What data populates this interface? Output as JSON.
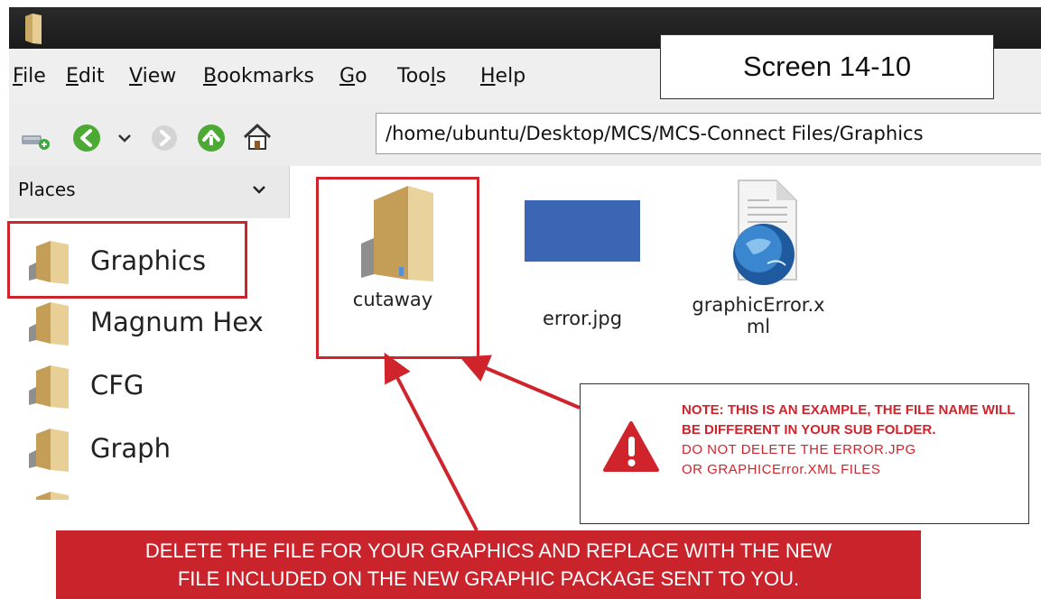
{
  "menu": {
    "items": [
      {
        "mnemonic": "F",
        "rest": "ile"
      },
      {
        "mnemonic": "E",
        "rest": "dit"
      },
      {
        "mnemonic": "V",
        "rest": "iew"
      },
      {
        "mnemonic": "B",
        "rest": "ookmarks"
      },
      {
        "mnemonic": "G",
        "rest": "o"
      },
      {
        "pre": "Too",
        "mnemonic": "l",
        "rest": "s"
      },
      {
        "mnemonic": "H",
        "rest": "elp"
      }
    ]
  },
  "screen_label": "Screen 14-10",
  "toolbar": {
    "icons": [
      "new-folder-icon",
      "back-icon",
      "history-dropdown-icon",
      "forward-icon",
      "up-icon",
      "home-icon"
    ],
    "path": "/home/ubuntu/Desktop/MCS/MCS-Connect Files/Graphics"
  },
  "sidebar": {
    "header": "Places",
    "items": [
      {
        "label": "Graphics"
      },
      {
        "label": "Magnum Hex"
      },
      {
        "label": "CFG"
      },
      {
        "label": "Graph"
      }
    ]
  },
  "files": [
    {
      "label": "cutaway",
      "icon": "folder-icon"
    },
    {
      "label": "error.jpg",
      "icon": "image-thumbnail-icon"
    },
    {
      "label_line1": "graphicError.x",
      "label_line2": "ml",
      "icon": "xml-globe-icon"
    }
  ],
  "note": {
    "bold_text": "NOTE: THIS IS AN EXAMPLE, THE FILE NAME WILL BE DIFFERENT IN YOUR SUB FOLDER.",
    "normal_line1": "DO NOT DELETE THE ERROR.JPG",
    "normal_line2": "OR GRAPHICError.XML FILES"
  },
  "banner": {
    "line1": "DELETE THE FILE FOR YOUR GRAPHICS AND REPLACE WITH THE NEW",
    "line2": "FILE INCLUDED ON THE NEW GRAPHIC PACKAGE SENT TO YOU."
  },
  "colors": {
    "accent_red": "#d0242c",
    "banner_red": "#c9242c",
    "folder_tan": "#d6b77a",
    "image_thumb_blue": "#3a66b3"
  }
}
